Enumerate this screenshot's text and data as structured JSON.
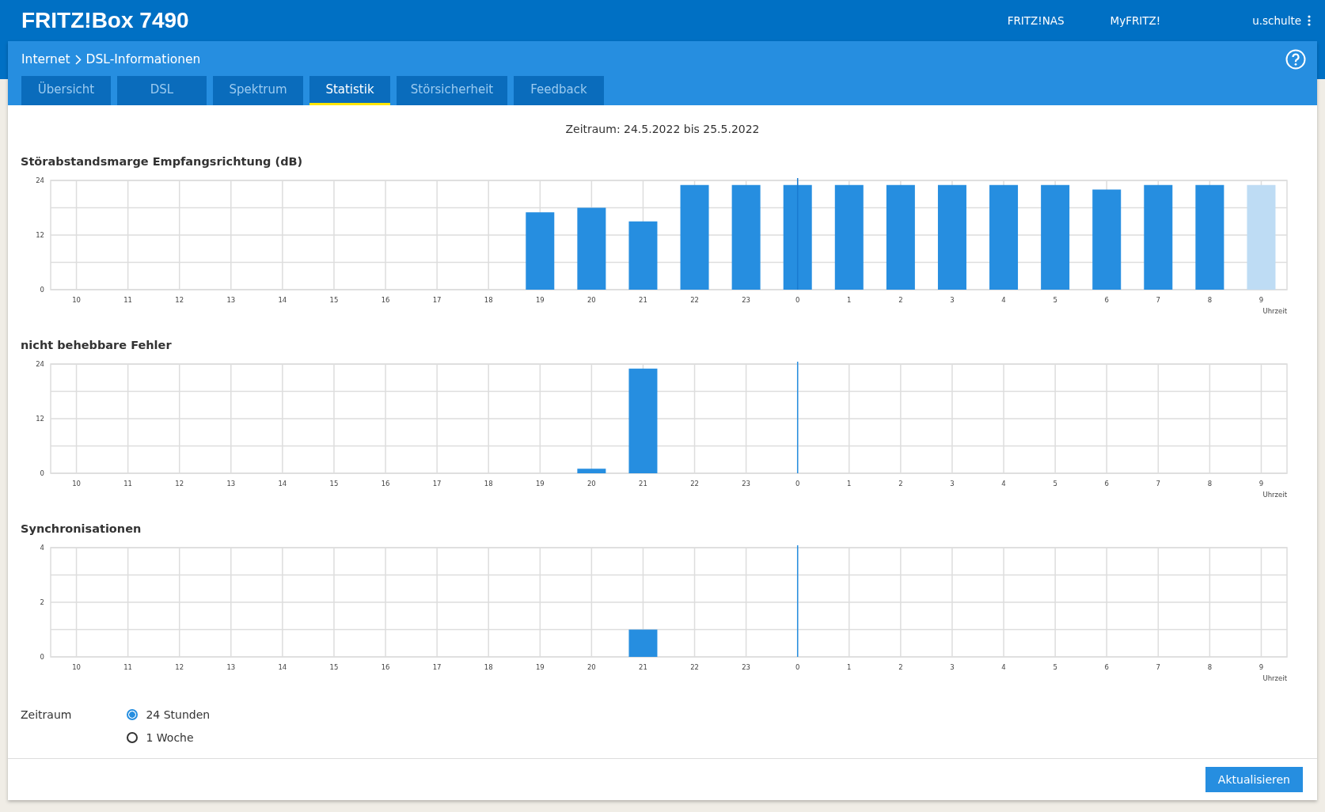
{
  "header": {
    "brand": "FRITZ!Box 7490",
    "links": [
      "FRITZ!NAS",
      "MyFRITZ!"
    ],
    "user": "u.schulte"
  },
  "breadcrumb": {
    "parent": "Internet",
    "current": "DSL-Informationen"
  },
  "tabs": [
    {
      "label": "Übersicht",
      "selected": false
    },
    {
      "label": "DSL",
      "selected": false
    },
    {
      "label": "Spektrum",
      "selected": false
    },
    {
      "label": "Statistik",
      "selected": true
    },
    {
      "label": "Störsicherheit",
      "selected": false
    },
    {
      "label": "Feedback",
      "selected": false
    }
  ],
  "period_text": "Zeitraum: 24.5.2022 bis 25.5.2022",
  "charts": [
    {
      "chart_data": {
        "type": "bar",
        "title": "Störabstandsmarge Empfangsrichtung (dB)",
        "xlabel": "Uhrzeit",
        "categories": [
          "10",
          "11",
          "12",
          "13",
          "14",
          "15",
          "16",
          "17",
          "18",
          "19",
          "20",
          "21",
          "22",
          "23",
          "0",
          "1",
          "2",
          "3",
          "4",
          "5",
          "6",
          "7",
          "8",
          "9"
        ],
        "grid": true,
        "ylim": [
          0,
          24
        ],
        "yticks": [
          0,
          12,
          24
        ],
        "ref_lines": [
          {
            "axis": "x",
            "value": "0",
            "color": "#1a7bd0"
          }
        ],
        "series": [
          {
            "color": "#268ee0",
            "values": [
              null,
              null,
              null,
              null,
              null,
              null,
              null,
              null,
              null,
              17,
              18,
              15,
              23,
              23,
              23,
              23,
              23,
              23,
              23,
              23,
              22,
              23,
              23,
              null
            ]
          },
          {
            "color": "#bedcf4",
            "values": [
              null,
              null,
              null,
              null,
              null,
              null,
              null,
              null,
              null,
              null,
              null,
              null,
              null,
              null,
              null,
              null,
              null,
              null,
              null,
              null,
              null,
              null,
              null,
              23
            ]
          }
        ]
      }
    },
    {
      "chart_data": {
        "type": "bar",
        "title": "nicht behebbare Fehler",
        "xlabel": "Uhrzeit",
        "categories": [
          "10",
          "11",
          "12",
          "13",
          "14",
          "15",
          "16",
          "17",
          "18",
          "19",
          "20",
          "21",
          "22",
          "23",
          "0",
          "1",
          "2",
          "3",
          "4",
          "5",
          "6",
          "7",
          "8",
          "9"
        ],
        "grid": true,
        "ylim": [
          0,
          24
        ],
        "yticks": [
          0,
          12,
          24
        ],
        "ref_lines": [
          {
            "axis": "x",
            "value": "0",
            "color": "#268ee0"
          }
        ],
        "series": [
          {
            "color": "#268ee0",
            "values": [
              null,
              null,
              null,
              null,
              null,
              null,
              null,
              null,
              null,
              null,
              1,
              23,
              null,
              null,
              null,
              null,
              null,
              null,
              null,
              null,
              null,
              null,
              null,
              null
            ]
          }
        ]
      }
    },
    {
      "chart_data": {
        "type": "bar",
        "title": "Synchronisationen",
        "xlabel": "Uhrzeit",
        "categories": [
          "10",
          "11",
          "12",
          "13",
          "14",
          "15",
          "16",
          "17",
          "18",
          "19",
          "20",
          "21",
          "22",
          "23",
          "0",
          "1",
          "2",
          "3",
          "4",
          "5",
          "6",
          "7",
          "8",
          "9"
        ],
        "grid": true,
        "ylim": [
          0,
          4
        ],
        "yticks": [
          0,
          2,
          4
        ],
        "ref_lines": [
          {
            "axis": "x",
            "value": "0",
            "color": "#268ee0"
          }
        ],
        "series": [
          {
            "color": "#268ee0",
            "values": [
              null,
              null,
              null,
              null,
              null,
              null,
              null,
              null,
              null,
              null,
              null,
              1,
              null,
              null,
              null,
              null,
              null,
              null,
              null,
              null,
              null,
              null,
              null,
              null
            ]
          }
        ]
      }
    }
  ],
  "period": {
    "label": "Zeitraum",
    "options": [
      {
        "label": "24 Stunden",
        "selected": true
      },
      {
        "label": "1 Woche",
        "selected": false
      }
    ]
  },
  "buttons": [
    "Aktualisieren"
  ]
}
